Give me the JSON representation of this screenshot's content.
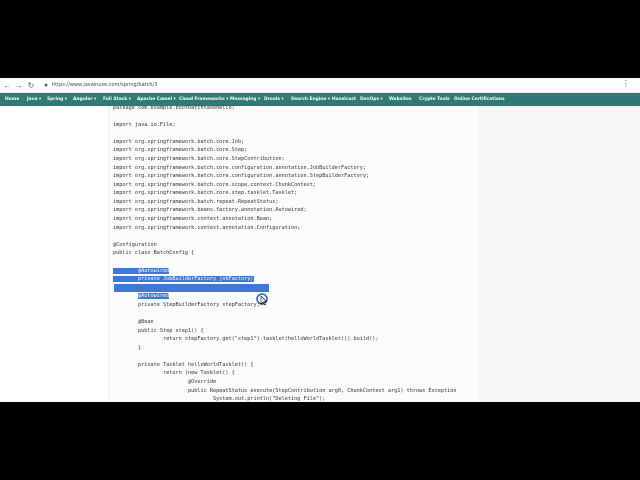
{
  "browser": {
    "back_icon": "arrow-left-icon",
    "forward_icon": "arrow-right-icon",
    "reload_icon": "reload-icon",
    "url": "https://www.javainuse.com/spring/batch/3",
    "menu_icon": "more-vert-icon"
  },
  "navbar": {
    "items": [
      {
        "label": "Home"
      },
      {
        "label": "Java ▾"
      },
      {
        "label": "Spring ▾"
      },
      {
        "label": "Angular ▾"
      },
      {
        "label": "Full Stack ▾"
      },
      {
        "label": "Apache Camel ▾"
      },
      {
        "label": "Cloud Frameworks ▾"
      },
      {
        "label": "Messaging ▾"
      },
      {
        "label": "Drools ▾"
      },
      {
        "label": "Search Engine ▾"
      },
      {
        "label": "Hazelcast"
      },
      {
        "label": "DevOps ▾"
      },
      {
        "label": "Websites"
      },
      {
        "label": "Crypto Tools"
      },
      {
        "label": "Online Certifications"
      }
    ],
    "color": "#2d7b77"
  },
  "code": {
    "lines": [
      "package com.example.bootbatchtaskhello;",
      "",
      "import java.io.File;",
      "",
      "import org.springframework.batch.core.Job;",
      "import org.springframework.batch.core.Step;",
      "import org.springframework.batch.core.StepContribution;",
      "import org.springframework.batch.core.configuration.annotation.JobBuilderFactory;",
      "import org.springframework.batch.core.configuration.annotation.StepBuilderFactory;",
      "import org.springframework.batch.core.scope.context.ChunkContext;",
      "import org.springframework.batch.core.step.tasklet.Tasklet;",
      "import org.springframework.batch.repeat.RepeatStatus;",
      "import org.springframework.beans.factory.annotation.Autowired;",
      "import org.springframework.context.annotation.Bean;",
      "import org.springframework.context.annotation.Configuration;",
      "",
      "@Configuration",
      "public class BatchConfig {",
      "",
      "        @Autowired",
      "        private JobBuilderFactory jobFactory;",
      "",
      "        @Autowired",
      "        private StepBuilderFactory stepFactory;",
      "",
      "        @Bean",
      "        public Step step1() {",
      "                return stepFactory.get(\"step1\").tasklet(helloWorldTasklet()).build();",
      "        }",
      "",
      "        private Tasklet helloWorldTasklet() {",
      "                return (new Tasklet() {",
      "                        @Override",
      "                        public RepeatStatus execute(StepContribution arg0, ChunkContext arg1) throws Exception",
      "                                System.out.println(\"Deleting File\");"
    ],
    "selection_color": "#3b78d9"
  }
}
